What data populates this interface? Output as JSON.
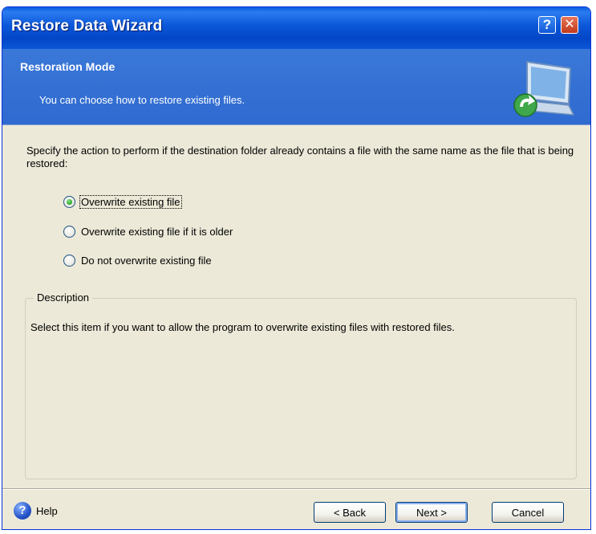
{
  "window": {
    "title": "Restore Data Wizard",
    "help_button": "?",
    "close_button": "✕"
  },
  "header": {
    "title": "Restoration Mode",
    "subtitle": "You can choose how to restore existing files.",
    "icon": "computer-restore-arrow-icon"
  },
  "content": {
    "prompt": "Specify the action to perform if the destination folder already contains a file with the same name as the file that is being restored:",
    "options": [
      {
        "label": "Overwrite existing file",
        "selected": true
      },
      {
        "label": "Overwrite existing file if it is older",
        "selected": false
      },
      {
        "label": "Do not overwrite existing file",
        "selected": false
      }
    ],
    "description": {
      "legend": "Description",
      "text": "Select this item if you want to allow the program to overwrite existing files with restored files."
    }
  },
  "footer": {
    "help_label": "Help",
    "back_label": "< Back",
    "next_label": "Next >",
    "cancel_label": "Cancel"
  },
  "colors": {
    "titlebar": "#0a56d8",
    "header": "#3a78d8",
    "dialog_bg": "#ece9d8",
    "radio_selected": "#21a121"
  }
}
